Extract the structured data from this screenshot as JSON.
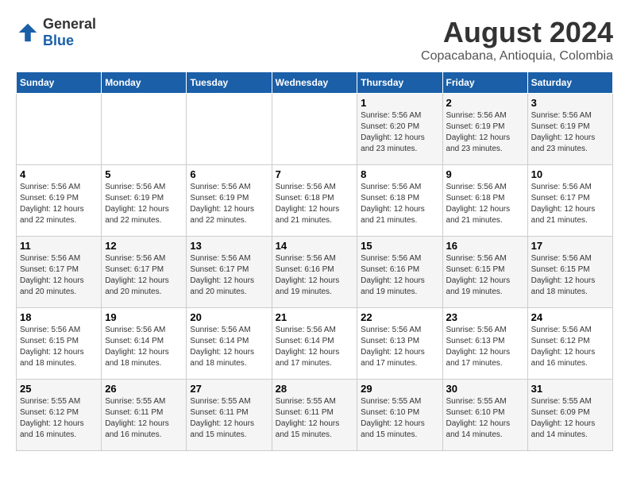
{
  "logo": {
    "text_general": "General",
    "text_blue": "Blue"
  },
  "title": "August 2024",
  "subtitle": "Copacabana, Antioquia, Colombia",
  "days_of_week": [
    "Sunday",
    "Monday",
    "Tuesday",
    "Wednesday",
    "Thursday",
    "Friday",
    "Saturday"
  ],
  "weeks": [
    [
      {
        "day": "",
        "info": ""
      },
      {
        "day": "",
        "info": ""
      },
      {
        "day": "",
        "info": ""
      },
      {
        "day": "",
        "info": ""
      },
      {
        "day": "1",
        "info": "Sunrise: 5:56 AM\nSunset: 6:20 PM\nDaylight: 12 hours\nand 23 minutes."
      },
      {
        "day": "2",
        "info": "Sunrise: 5:56 AM\nSunset: 6:19 PM\nDaylight: 12 hours\nand 23 minutes."
      },
      {
        "day": "3",
        "info": "Sunrise: 5:56 AM\nSunset: 6:19 PM\nDaylight: 12 hours\nand 23 minutes."
      }
    ],
    [
      {
        "day": "4",
        "info": "Sunrise: 5:56 AM\nSunset: 6:19 PM\nDaylight: 12 hours\nand 22 minutes."
      },
      {
        "day": "5",
        "info": "Sunrise: 5:56 AM\nSunset: 6:19 PM\nDaylight: 12 hours\nand 22 minutes."
      },
      {
        "day": "6",
        "info": "Sunrise: 5:56 AM\nSunset: 6:19 PM\nDaylight: 12 hours\nand 22 minutes."
      },
      {
        "day": "7",
        "info": "Sunrise: 5:56 AM\nSunset: 6:18 PM\nDaylight: 12 hours\nand 21 minutes."
      },
      {
        "day": "8",
        "info": "Sunrise: 5:56 AM\nSunset: 6:18 PM\nDaylight: 12 hours\nand 21 minutes."
      },
      {
        "day": "9",
        "info": "Sunrise: 5:56 AM\nSunset: 6:18 PM\nDaylight: 12 hours\nand 21 minutes."
      },
      {
        "day": "10",
        "info": "Sunrise: 5:56 AM\nSunset: 6:17 PM\nDaylight: 12 hours\nand 21 minutes."
      }
    ],
    [
      {
        "day": "11",
        "info": "Sunrise: 5:56 AM\nSunset: 6:17 PM\nDaylight: 12 hours\nand 20 minutes."
      },
      {
        "day": "12",
        "info": "Sunrise: 5:56 AM\nSunset: 6:17 PM\nDaylight: 12 hours\nand 20 minutes."
      },
      {
        "day": "13",
        "info": "Sunrise: 5:56 AM\nSunset: 6:17 PM\nDaylight: 12 hours\nand 20 minutes."
      },
      {
        "day": "14",
        "info": "Sunrise: 5:56 AM\nSunset: 6:16 PM\nDaylight: 12 hours\nand 19 minutes."
      },
      {
        "day": "15",
        "info": "Sunrise: 5:56 AM\nSunset: 6:16 PM\nDaylight: 12 hours\nand 19 minutes."
      },
      {
        "day": "16",
        "info": "Sunrise: 5:56 AM\nSunset: 6:15 PM\nDaylight: 12 hours\nand 19 minutes."
      },
      {
        "day": "17",
        "info": "Sunrise: 5:56 AM\nSunset: 6:15 PM\nDaylight: 12 hours\nand 18 minutes."
      }
    ],
    [
      {
        "day": "18",
        "info": "Sunrise: 5:56 AM\nSunset: 6:15 PM\nDaylight: 12 hours\nand 18 minutes."
      },
      {
        "day": "19",
        "info": "Sunrise: 5:56 AM\nSunset: 6:14 PM\nDaylight: 12 hours\nand 18 minutes."
      },
      {
        "day": "20",
        "info": "Sunrise: 5:56 AM\nSunset: 6:14 PM\nDaylight: 12 hours\nand 18 minutes."
      },
      {
        "day": "21",
        "info": "Sunrise: 5:56 AM\nSunset: 6:14 PM\nDaylight: 12 hours\nand 17 minutes."
      },
      {
        "day": "22",
        "info": "Sunrise: 5:56 AM\nSunset: 6:13 PM\nDaylight: 12 hours\nand 17 minutes."
      },
      {
        "day": "23",
        "info": "Sunrise: 5:56 AM\nSunset: 6:13 PM\nDaylight: 12 hours\nand 17 minutes."
      },
      {
        "day": "24",
        "info": "Sunrise: 5:56 AM\nSunset: 6:12 PM\nDaylight: 12 hours\nand 16 minutes."
      }
    ],
    [
      {
        "day": "25",
        "info": "Sunrise: 5:55 AM\nSunset: 6:12 PM\nDaylight: 12 hours\nand 16 minutes."
      },
      {
        "day": "26",
        "info": "Sunrise: 5:55 AM\nSunset: 6:11 PM\nDaylight: 12 hours\nand 16 minutes."
      },
      {
        "day": "27",
        "info": "Sunrise: 5:55 AM\nSunset: 6:11 PM\nDaylight: 12 hours\nand 15 minutes."
      },
      {
        "day": "28",
        "info": "Sunrise: 5:55 AM\nSunset: 6:11 PM\nDaylight: 12 hours\nand 15 minutes."
      },
      {
        "day": "29",
        "info": "Sunrise: 5:55 AM\nSunset: 6:10 PM\nDaylight: 12 hours\nand 15 minutes."
      },
      {
        "day": "30",
        "info": "Sunrise: 5:55 AM\nSunset: 6:10 PM\nDaylight: 12 hours\nand 14 minutes."
      },
      {
        "day": "31",
        "info": "Sunrise: 5:55 AM\nSunset: 6:09 PM\nDaylight: 12 hours\nand 14 minutes."
      }
    ]
  ]
}
